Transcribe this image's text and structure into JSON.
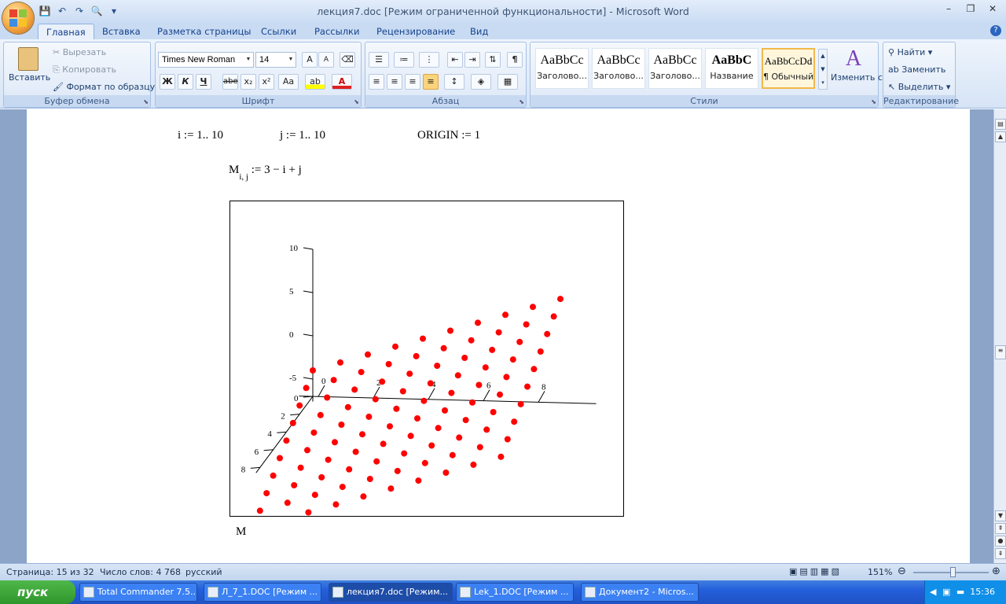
{
  "window": {
    "title": "лекция7.doc [Режим ограниченной функциональности] - Microsoft Word"
  },
  "tabs": [
    "Главная",
    "Вставка",
    "Разметка страницы",
    "Ссылки",
    "Рассылки",
    "Рецензирование",
    "Вид"
  ],
  "ribbon": {
    "clipboard": {
      "title": "Буфер обмена",
      "paste": "Вставить",
      "cut": "Вырезать",
      "copy": "Копировать",
      "format_painter": "Формат по образцу"
    },
    "font": {
      "title": "Шрифт",
      "font_name": "Times New Roman",
      "font_size": "14",
      "bold": "Ж",
      "italic": "К",
      "underline": "Ч",
      "strike": "abe",
      "subscript": "x₂",
      "superscript": "x²",
      "case": "Aa"
    },
    "paragraph": {
      "title": "Абзац",
      "pilcrow": "¶"
    },
    "styles": {
      "title": "Стили",
      "change_styles": "Изменить стили",
      "items": [
        {
          "sample": "AaBbCc",
          "name": "Заголово..."
        },
        {
          "sample": "AaBbCc",
          "name": "Заголово..."
        },
        {
          "sample": "AaBbCc",
          "name": "Заголово..."
        },
        {
          "sample": "AaBbC",
          "name": "Название"
        },
        {
          "sample": "AaBbCcDd",
          "name": "¶ Обычный"
        }
      ]
    },
    "editing": {
      "title": "Редактирование",
      "find": "Найти",
      "replace": "Заменить",
      "select": "Выделить"
    }
  },
  "document": {
    "line1": {
      "a": "i := 1.. 10",
      "b": "j := 1.. 10",
      "c": "ORIGIN := 1"
    },
    "formula_m": "M",
    "formula_sub": "i, j",
    "formula_rhs": ":= 3 − i + j",
    "caption": "M"
  },
  "chart_data": {
    "type": "scatter",
    "xlabel": "",
    "ylabel": "",
    "z_ticks": [
      "10",
      "5",
      "0",
      "-5"
    ],
    "j_ticks": [
      "0",
      "2",
      "4",
      "6",
      "8"
    ],
    "i_ticks": [
      "0",
      "2",
      "4",
      "6",
      "8"
    ],
    "point_color": "#ff0000",
    "grid_size": 10,
    "formula": "M(i,j) = 3 - i + j"
  },
  "status": {
    "page": "Страница: 15 из 32",
    "words": "Число слов: 4 768",
    "lang": "русский",
    "zoom": "151%"
  },
  "taskbar": {
    "start": "пуск",
    "items": [
      "Total Commander 7.5...",
      "Л_7_1.DOC [Режим ...",
      "лекция7.doc [Режим...",
      "Lek_1.DOC [Режим ...",
      "Документ2 - Micros..."
    ],
    "clock": "15:36"
  }
}
